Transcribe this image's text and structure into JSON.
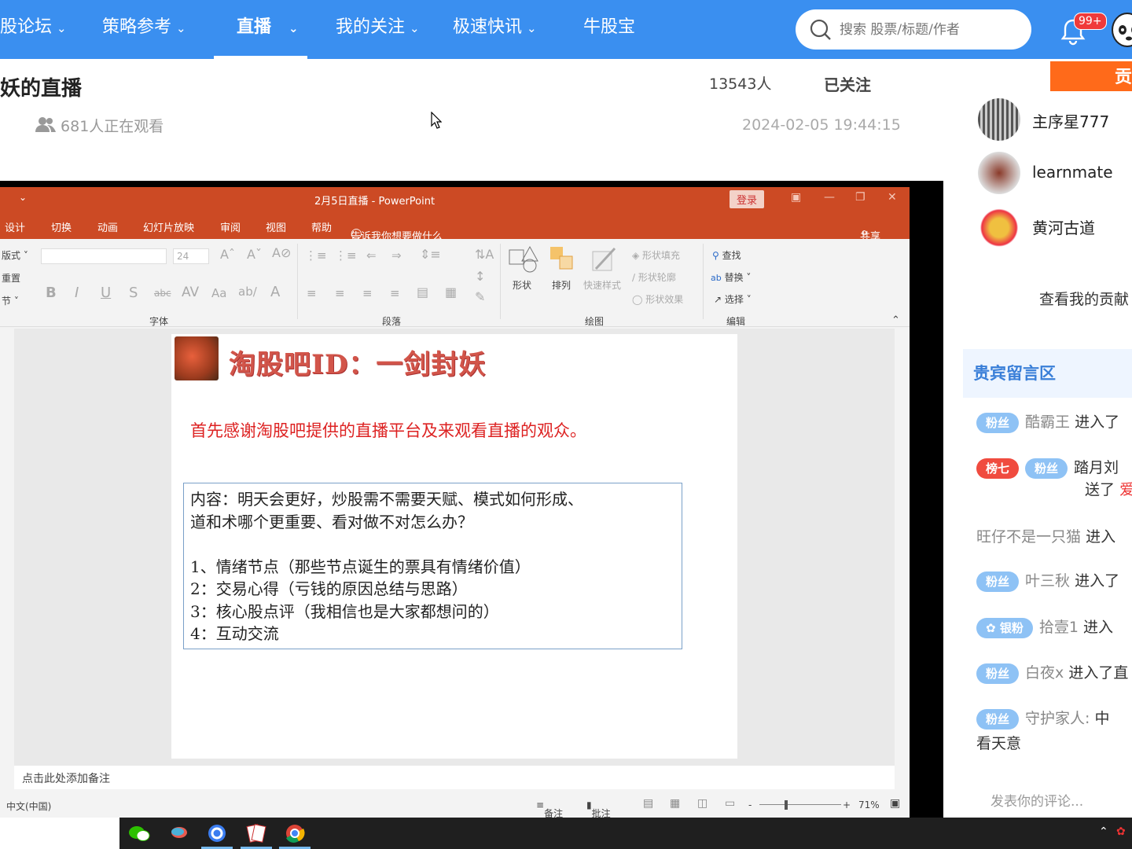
{
  "nav": {
    "items": [
      {
        "label": "股论坛",
        "chevron": true
      },
      {
        "label": "策略参考",
        "chevron": true
      },
      {
        "label": "直播",
        "chevron": true,
        "active": true
      },
      {
        "label": "我的关注",
        "chevron": true
      },
      {
        "label": "极速快讯",
        "chevron": true
      },
      {
        "label": "牛股宝",
        "chevron": false
      }
    ],
    "search_placeholder": "搜索 股票/标题/作者",
    "notification_badge": "99+",
    "accent": "#3a8ff0"
  },
  "header": {
    "title": "妖的直播",
    "fans": "13543人",
    "follow_label": "已关注",
    "watching": "681人正在观看",
    "datetime": "2024-02-05 19:44:15"
  },
  "ppt": {
    "window_title": "2月5日直播 - PowerPoint",
    "login": "登录",
    "share": "共享",
    "tell_me": "告诉我你想要做什么",
    "menu": [
      "设计",
      "切换",
      "动画",
      "幻灯片放映",
      "审阅",
      "视图",
      "帮助"
    ],
    "ribbon": {
      "layout": "版式",
      "reset": "重置",
      "section": "节",
      "font_size": "24",
      "group_font": "字体",
      "group_paragraph": "段落",
      "group_drawing": "绘图",
      "group_edit": "编辑",
      "shape": "形状",
      "arrange": "排列",
      "quick_style": "快速样式",
      "shape_fill": "形状填充",
      "shape_outline": "形状轮廓",
      "shape_effect": "形状效果",
      "find": "查找",
      "replace": "替换",
      "select": "选择"
    },
    "slide": {
      "heading": "淘股吧ID：一剑封妖",
      "thanks": "首先感谢淘股吧提供的直播平台及来观看直播的观众。",
      "lines": [
        "内容：明天会更好，炒股需不需要天赋、模式如何形成、",
        "道和术哪个更重要、看对做不对怎么办？",
        "",
        "1、情绪节点（那些节点诞生的票具有情绪价值）",
        "2：交易心得（亏钱的原因总结与思路）",
        "3：核心股点评（我相信也是大家都想问的）",
        "4：互动交流"
      ]
    },
    "notes_placeholder": "点击此处添加备注",
    "status": {
      "language": "中文(中国)",
      "notes": "备注",
      "comments": "批注",
      "zoom": "71%"
    },
    "accent": "#cc4a24"
  },
  "sidebar": {
    "tag": "贡",
    "users": [
      {
        "name": "主序星777"
      },
      {
        "name": "learnmate"
      },
      {
        "name": "黄河古道"
      }
    ],
    "my_contribution": "查看我的贡献",
    "guest_title": "贵宾留言区",
    "messages": [
      {
        "badges": [
          "粉丝"
        ],
        "user": "酷霸王",
        "action": "进入了"
      },
      {
        "badges": [
          "榜七",
          "粉丝"
        ],
        "user": "踏月刘",
        "action": "",
        "line2": "送了",
        "gift": "爱"
      },
      {
        "badges": [],
        "user": "旺仔不是一只猫",
        "action": "进入"
      },
      {
        "badges": [
          "粉丝"
        ],
        "user": "叶三秋",
        "action": "进入了"
      },
      {
        "badges": [
          "银粉"
        ],
        "user": "拾壹1",
        "action": "进入"
      },
      {
        "badges": [
          "粉丝"
        ],
        "user": "白夜x",
        "action": "进入了直"
      },
      {
        "badges": [
          "粉丝"
        ],
        "user": "守护家人:",
        "action": "中",
        "line2": "看天意"
      }
    ],
    "comment_placeholder": "发表你的评论..."
  }
}
